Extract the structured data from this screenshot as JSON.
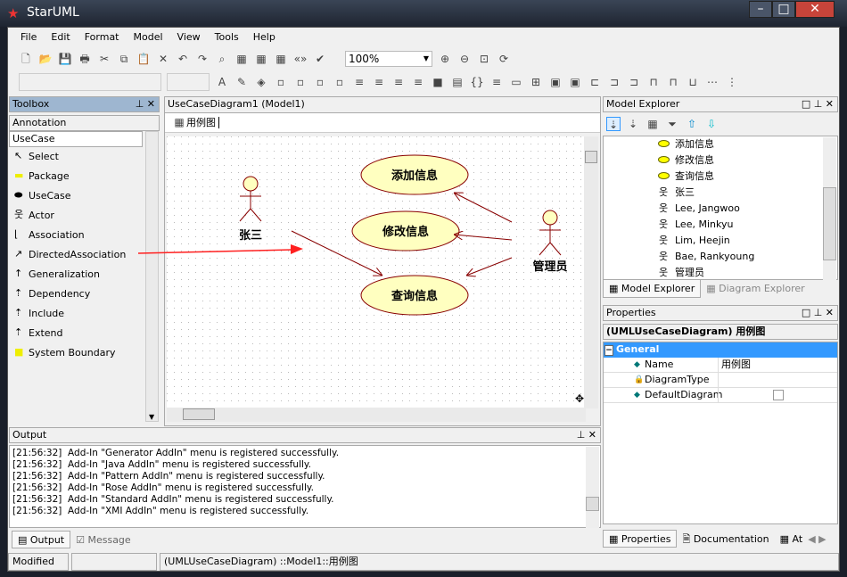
{
  "window": {
    "title": "StarUML"
  },
  "menu": [
    "File",
    "Edit",
    "Format",
    "Model",
    "View",
    "Tools",
    "Help"
  ],
  "toolbar": {
    "zoom": "100%"
  },
  "toolbox": {
    "title": "Toolbox",
    "sections": [
      "Annotation",
      "UseCase"
    ],
    "items": [
      {
        "label": "Select",
        "icon": "pointer-icon"
      },
      {
        "label": "Package",
        "icon": "package-icon"
      },
      {
        "label": "UseCase",
        "icon": "usecase-icon"
      },
      {
        "label": "Actor",
        "icon": "actor-icon"
      },
      {
        "label": "Association",
        "icon": "association-icon"
      },
      {
        "label": "DirectedAssociation",
        "icon": "directed-association-icon"
      },
      {
        "label": "Generalization",
        "icon": "generalization-icon"
      },
      {
        "label": "Dependency",
        "icon": "dependency-icon"
      },
      {
        "label": "Include",
        "icon": "include-icon"
      },
      {
        "label": "Extend",
        "icon": "extend-icon"
      },
      {
        "label": "System Boundary",
        "icon": "system-boundary-icon"
      }
    ]
  },
  "diagram": {
    "title": "UseCaseDiagram1 (Model1)",
    "tab": "用例图",
    "usecases": [
      "添加信息",
      "修改信息",
      "查询信息"
    ],
    "actors": [
      "张三",
      "管理员"
    ],
    "annotation_color": "#ff2020"
  },
  "model_explorer": {
    "title": "Model Explorer",
    "items": [
      {
        "label": "添加信息",
        "type": "usecase"
      },
      {
        "label": "修改信息",
        "type": "usecase"
      },
      {
        "label": "查询信息",
        "type": "usecase"
      },
      {
        "label": "张三",
        "type": "actor"
      },
      {
        "label": "Lee, Jangwoo",
        "type": "actor"
      },
      {
        "label": "Lee, Minkyu",
        "type": "actor"
      },
      {
        "label": "Lim, Heejin",
        "type": "actor"
      },
      {
        "label": "Bae, Rankyoung",
        "type": "actor"
      },
      {
        "label": "管理员",
        "type": "actor"
      }
    ],
    "tabs": [
      "Model Explorer",
      "Diagram Explorer"
    ]
  },
  "properties": {
    "title": "Properties",
    "header": "(UMLUseCaseDiagram) 用例图",
    "group": "General",
    "rows": [
      {
        "name": "Name",
        "value": "用例图"
      },
      {
        "name": "DiagramType",
        "value": ""
      },
      {
        "name": "DefaultDiagram",
        "value": ""
      }
    ],
    "default_diagram_checked": false,
    "tabs": [
      "Properties",
      "Documentation",
      "At"
    ]
  },
  "output": {
    "title": "Output",
    "lines": [
      "[21:56:32]  Add-In \"Generator AddIn\" menu is registered successfully.",
      "[21:56:32]  Add-In \"Java AddIn\" menu is registered successfully.",
      "[21:56:32]  Add-In \"Pattern AddIn\" menu is registered successfully.",
      "[21:56:32]  Add-In \"Rose AddIn\" menu is registered successfully.",
      "[21:56:32]  Add-In \"Standard AddIn\" menu is registered successfully.",
      "[21:56:32]  Add-In \"XMI AddIn\" menu is registered successfully."
    ],
    "tabs": [
      "Output",
      "Message"
    ]
  },
  "status": {
    "mode": "Modified",
    "path": "(UMLUseCaseDiagram) ::Model1::用例图"
  }
}
